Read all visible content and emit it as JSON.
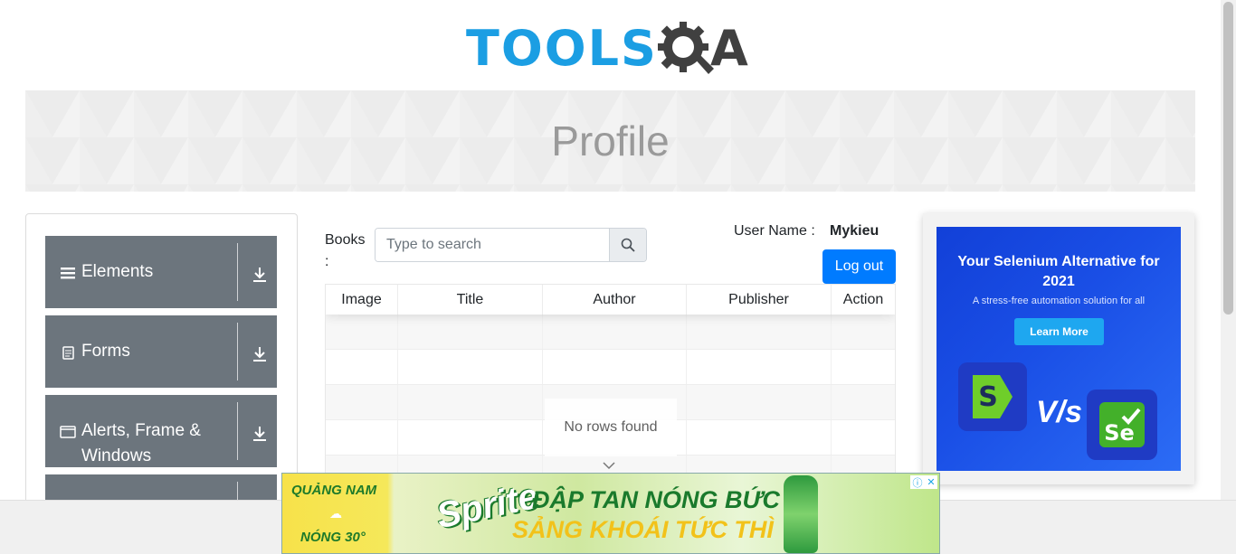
{
  "logo": {
    "tools": "TOOLS",
    "qa": "QA"
  },
  "banner": {
    "title": "Profile"
  },
  "left_menu": {
    "groups": [
      {
        "label": "Elements",
        "icon": "hamburger-icon"
      },
      {
        "label": "Forms",
        "icon": "document-icon"
      },
      {
        "label": "Alerts, Frame & Windows",
        "icon": "window-icon"
      },
      {
        "label": "",
        "icon": ""
      }
    ]
  },
  "books": {
    "label": "Books :",
    "search_placeholder": "Type to search"
  },
  "user": {
    "label": "User Name :",
    "value": "Mykieu",
    "logout_label": "Log out"
  },
  "table": {
    "headers": [
      "Image",
      "Title",
      "Author",
      "Publisher",
      "Action"
    ],
    "empty_message": "No rows found"
  },
  "right_ad": {
    "headline": "Your Selenium Alternative for 2021",
    "subtitle": "A stress-free automation solution for all",
    "cta": "Learn More",
    "vs": "V/s",
    "left_logo": "S",
    "right_logo": "Se"
  },
  "bottom_ad": {
    "location": "QUẢNG NAM",
    "weather": "NÓNG 30°",
    "brand": "Sprite",
    "line1": "ĐẬP TAN NÓNG BỨC",
    "line2": "SẢNG KHOÁI TỨC THÌ"
  },
  "colors": {
    "primary": "#007bff",
    "menu_bg": "#6c757d",
    "logo_blue": "#1b9ee3",
    "logo_dark": "#404040"
  }
}
